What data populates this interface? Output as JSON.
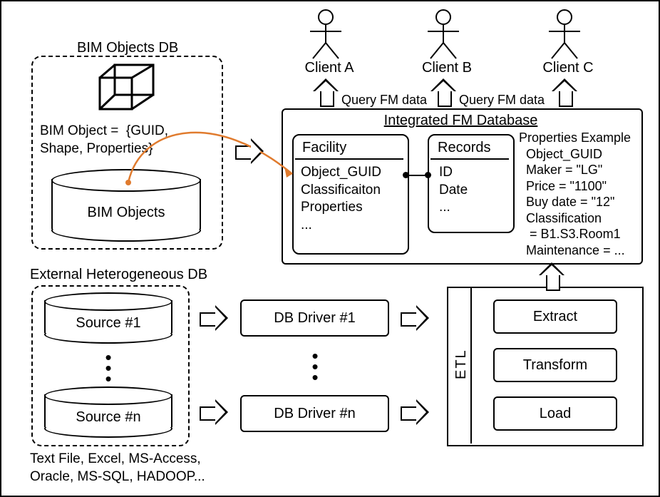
{
  "bim_db": {
    "title": "BIM Objects DB",
    "object_def": "BIM Object =  {GUID,\nShape, Properties}",
    "cyl_label": "BIM Objects"
  },
  "clients": {
    "a": "Client A",
    "b": "Client B",
    "c": "Client C",
    "query_ab": "Query FM data",
    "query_bc": "Query FM data"
  },
  "fmdb": {
    "title": "Integrated FM Database",
    "facility": {
      "header": "Facility",
      "rows": "Object_GUID\nClassificaiton\nProperties\n..."
    },
    "records": {
      "header": "Records",
      "rows": "ID\nDate\n..."
    },
    "props_example": "Properties Example\n  Object_GUID\n  Maker = \"LG\"\n  Price = \"1100\"\n  Buy date = \"12\"\n  Classification\n   = B1.S3.Room1\n  Maintenance = ..."
  },
  "ext": {
    "title": "External Heterogeneous DB",
    "source1": "Source #1",
    "sourcen": "Source #n",
    "driver1": "DB Driver #1",
    "drivern": "DB Driver #n",
    "note": "Text File, Excel, MS-Access,\nOracle, MS-SQL, HADOOP..."
  },
  "etl": {
    "label": "ETL",
    "extract": "Extract",
    "transform": "Transform",
    "load": "Load"
  }
}
